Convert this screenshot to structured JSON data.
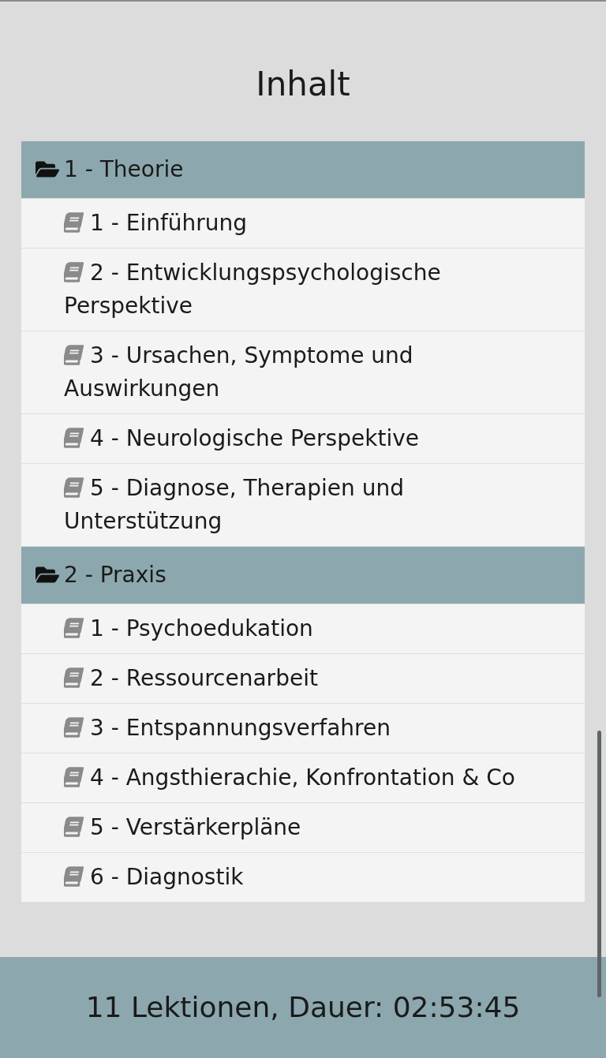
{
  "title": "Inhalt",
  "sections": [
    {
      "label": "1 - Theorie",
      "expanded": true,
      "children": [
        {
          "label": "1 - Einführung"
        },
        {
          "label": "2 - Entwicklungspsychologische Perspektive"
        },
        {
          "label": "3 - Ursachen, Symptome und Auswirkungen"
        },
        {
          "label": "4 - Neurologische Perspektive"
        },
        {
          "label": "5 - Diagnose, Therapien und Unterstützung"
        }
      ]
    },
    {
      "label": "2 - Praxis",
      "expanded": true,
      "children": [
        {
          "label": "1 - Psychoedukation"
        },
        {
          "label": "2 - Ressourcenarbeit"
        },
        {
          "label": "3 - Entspannungsverfahren"
        },
        {
          "label": "4 - Angsthierachie, Konfrontation & Co"
        },
        {
          "label": "5 - Verstärkerpläne"
        },
        {
          "label": "6 - Diagnostik"
        }
      ]
    }
  ],
  "footer": "11 Lektionen, Dauer: 02:53:45"
}
